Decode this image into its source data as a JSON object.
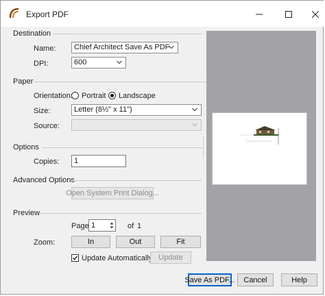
{
  "window": {
    "title": "Export PDF"
  },
  "sections": {
    "destination": "Destination",
    "paper": "Paper",
    "options": "Options",
    "advanced": "Advanced Options",
    "preview": "Preview"
  },
  "destination": {
    "name_label": "Name:",
    "name_value": "Chief Architect Save As PDF",
    "dpi_label": "DPI:",
    "dpi_value": "600"
  },
  "paper": {
    "orientation_label": "Orientation:",
    "portrait_label": "Portrait",
    "landscape_label": "Landscape",
    "orientation_selected": "Landscape",
    "size_label": "Size:",
    "size_value": "Letter (8½\" x 11\")",
    "source_label": "Source:",
    "source_value": ""
  },
  "options": {
    "copies_label": "Copies:",
    "copies_value": "1"
  },
  "advanced": {
    "system_dialog_button": "Open System Print Dialog..."
  },
  "preview": {
    "page_label": "Page",
    "page_value": "1",
    "of_label": "of",
    "total_pages": "1",
    "zoom_label": "Zoom:",
    "zoom_in": "In",
    "zoom_out": "Out",
    "zoom_fit": "Fit",
    "update_auto_label": "Update Automatically",
    "update_auto_checked": true,
    "update_button": "Update"
  },
  "footer": {
    "save_button": "Save As PDF...",
    "cancel_button": "Cancel",
    "help_button": "Help"
  },
  "icons": {
    "app": "chief-architect-logo-icon",
    "minimize": "minimize-icon",
    "maximize": "maximize-icon",
    "close": "close-icon"
  },
  "colors": {
    "preview_background": "#a3a3a7",
    "default_button_border": "#0a64c8",
    "app_icon": "#8a4a12"
  }
}
